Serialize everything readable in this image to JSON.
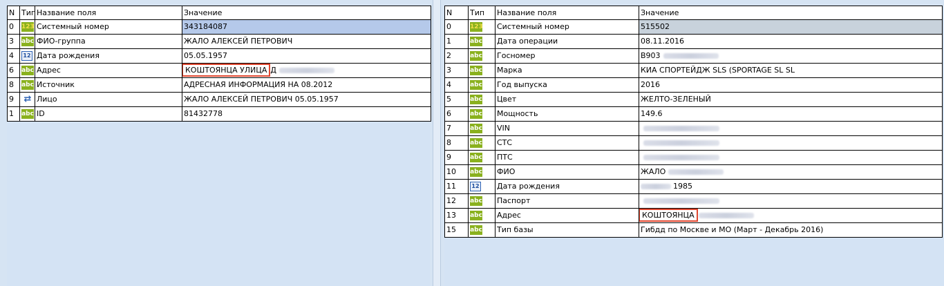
{
  "columns": {
    "n": "N",
    "type": "Тип",
    "field": "Название поля",
    "value": "Значение"
  },
  "left": {
    "rows": [
      {
        "n": "0",
        "type": "num",
        "field": "Системный номер",
        "value": "343184087",
        "selected": true
      },
      {
        "n": "3",
        "type": "abc",
        "field": "ФИО-группа",
        "value": "ЖАЛО АЛЕКСЕЙ ПЕТРОВИЧ"
      },
      {
        "n": "4",
        "type": "cal",
        "field": "Дата рождения",
        "value": "05.05.1957"
      },
      {
        "n": "6",
        "type": "abc",
        "field": "Адрес",
        "value": "КОШТОЯНЦА УЛИЦА",
        "suffix": "Д",
        "blurred": true,
        "highlight": true
      },
      {
        "n": "8",
        "type": "abc",
        "field": "Источник",
        "value": "АДРЕСНАЯ ИНФОРМАЦИЯ НА 08.2012"
      },
      {
        "n": "9",
        "type": "link",
        "field": "Лицо",
        "value": "ЖАЛО АЛЕКСЕЙ ПЕТРОВИЧ 05.05.1957"
      },
      {
        "n": "1",
        "type": "abc",
        "field": "ID",
        "value": "81432778"
      }
    ]
  },
  "right": {
    "rows": [
      {
        "n": "0",
        "type": "num",
        "field": "Системный номер",
        "value": "515502",
        "selected": true
      },
      {
        "n": "1",
        "type": "abc",
        "field": "Дата операции",
        "value": "08.11.2016"
      },
      {
        "n": "2",
        "type": "abc",
        "field": "Госномер",
        "value": "В903",
        "blurred": true
      },
      {
        "n": "3",
        "type": "abc",
        "field": "Марка",
        "value": "КИА СПОРТЕЙДЖ SLS (SPORTAGE SL SL"
      },
      {
        "n": "4",
        "type": "abc",
        "field": "Год выпуска",
        "value": "2016"
      },
      {
        "n": "5",
        "type": "abc",
        "field": "Цвет",
        "value": "ЖЕЛТО-ЗЕЛЕНЫЙ"
      },
      {
        "n": "6",
        "type": "abc",
        "field": "Мощность",
        "value": "149.6"
      },
      {
        "n": "7",
        "type": "abc",
        "field": "VIN",
        "value": "",
        "blurred": true
      },
      {
        "n": "8",
        "type": "abc",
        "field": "СТС",
        "value": "",
        "blurred": true
      },
      {
        "n": "9",
        "type": "abc",
        "field": "ПТС",
        "value": "",
        "blurred": true
      },
      {
        "n": "10",
        "type": "abc",
        "field": "ФИО",
        "value": "ЖАЛО",
        "blurred": true
      },
      {
        "n": "11",
        "type": "cal",
        "field": "Дата рождения",
        "value": "",
        "blurredPrefix": true,
        "suffix": "1985"
      },
      {
        "n": "12",
        "type": "abc",
        "field": "Паспорт",
        "value": "",
        "blurred": true
      },
      {
        "n": "13",
        "type": "abc",
        "field": "Адрес",
        "value": "КОШТОЯНЦА",
        "blurred": true,
        "highlight": true
      },
      {
        "n": "15",
        "type": "abc",
        "field": "Тип базы",
        "value": "Гибдд по Москве и МО (Март - Декабрь 2016)"
      }
    ]
  },
  "icons": {
    "abc": "abc",
    "num": "123",
    "cal": "12",
    "link": "⇄"
  }
}
